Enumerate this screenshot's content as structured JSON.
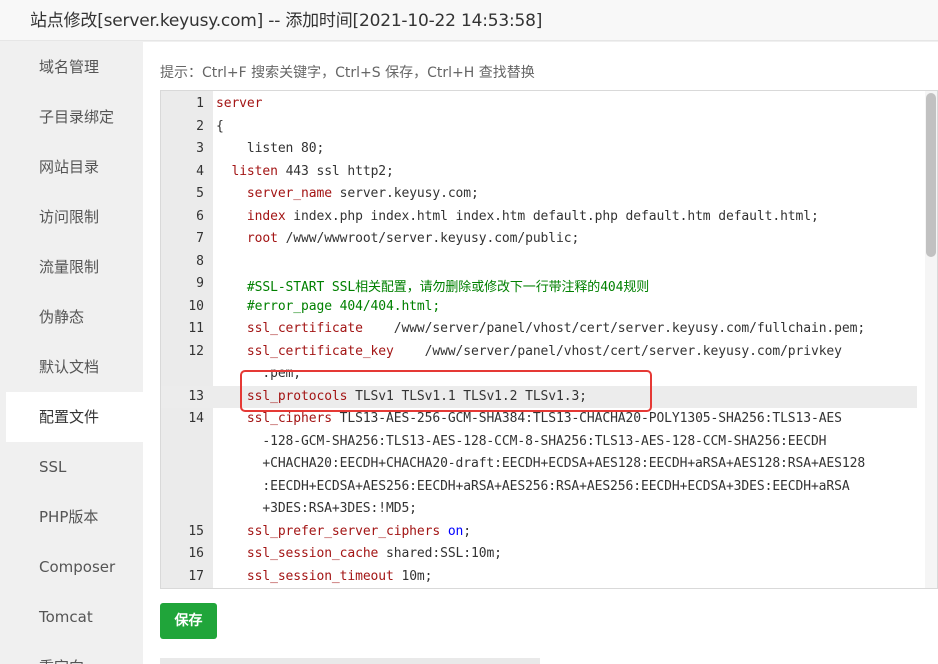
{
  "window": {
    "title": "站点修改[server.keyusy.com] -- 添加时间[2021-10-22 14:53:58]"
  },
  "sidebar": {
    "items": [
      {
        "label": "域名管理"
      },
      {
        "label": "子目录绑定"
      },
      {
        "label": "网站目录"
      },
      {
        "label": "访问限制"
      },
      {
        "label": "流量限制"
      },
      {
        "label": "伪静态"
      },
      {
        "label": "默认文档"
      },
      {
        "label": "配置文件",
        "active": true
      },
      {
        "label": "SSL"
      },
      {
        "label": "PHP版本"
      },
      {
        "label": "Composer"
      },
      {
        "label": "Tomcat"
      },
      {
        "label": "重定向"
      }
    ]
  },
  "editor": {
    "hint": "提示：Ctrl+F 搜索关键字，Ctrl+S 保存，Ctrl+H 查找替换",
    "lines": [
      {
        "num": "1",
        "code": "server"
      },
      {
        "num": "2",
        "code": "{"
      },
      {
        "num": "3",
        "code": "    listen 80;"
      },
      {
        "num": "4",
        "code": "  listen 443 ssl http2;"
      },
      {
        "num": "5",
        "code": "    server_name server.keyusy.com;"
      },
      {
        "num": "6",
        "code": "    index index.php index.html index.htm default.php default.htm default.html;"
      },
      {
        "num": "7",
        "code": "    root /www/wwwroot/server.keyusy.com/public;"
      },
      {
        "num": "8",
        "code": ""
      },
      {
        "num": "9",
        "code": "    #SSL-START SSL相关配置，请勿删除或修改下一行带注释的404规则"
      },
      {
        "num": "10",
        "code": "    #error_page 404/404.html;"
      },
      {
        "num": "11",
        "code": "    ssl_certificate    /www/server/panel/vhost/cert/server.keyusy.com/fullchain.pem;"
      },
      {
        "num": "12",
        "code": "    ssl_certificate_key    /www/server/panel/vhost/cert/server.keyusy.com/privkey"
      },
      {
        "num": "",
        "code": "      .pem;"
      },
      {
        "num": "13",
        "code": "    ssl_protocols TLSv1 TLSv1.1 TLSv1.2 TLSv1.3;"
      },
      {
        "num": "14",
        "code": "    ssl_ciphers TLS13-AES-256-GCM-SHA384:TLS13-CHACHA20-POLY1305-SHA256:TLS13-AES"
      },
      {
        "num": "",
        "code": "      -128-GCM-SHA256:TLS13-AES-128-CCM-8-SHA256:TLS13-AES-128-CCM-SHA256:EECDH"
      },
      {
        "num": "",
        "code": "      +CHACHA20:EECDH+CHACHA20-draft:EECDH+ECDSA+AES128:EECDH+aRSA+AES128:RSA+AES128"
      },
      {
        "num": "",
        "code": "      :EECDH+ECDSA+AES256:EECDH+aRSA+AES256:RSA+AES256:EECDH+ECDSA+3DES:EECDH+aRSA"
      },
      {
        "num": "",
        "code": "      +3DES:RSA+3DES:!MD5;"
      },
      {
        "num": "15",
        "code": "    ssl_prefer_server_ciphers on;"
      },
      {
        "num": "16",
        "code": "    ssl_session_cache shared:SSL:10m;"
      },
      {
        "num": "17",
        "code": "    ssl_session_timeout 10m;"
      }
    ]
  },
  "actions": {
    "save_label": "保存"
  },
  "colors": {
    "accent": "#20a53a",
    "highlight_box": "#e53935",
    "keyword": "#a31515",
    "comment": "#008000"
  }
}
